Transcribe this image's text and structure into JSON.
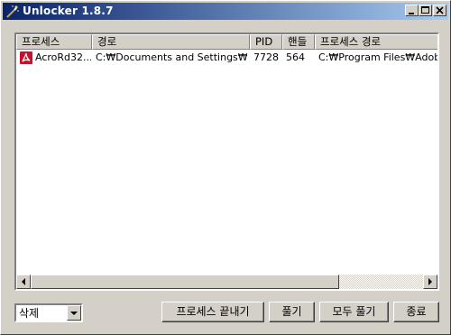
{
  "window": {
    "title": "Unlocker 1.8.7"
  },
  "list": {
    "columns": [
      "프로세스",
      "경로",
      "PID",
      "핸들",
      "프로세스 경로"
    ],
    "rows": [
      {
        "process": "AcroRd32...",
        "path": "C:₩Documents and Settings₩...",
        "pid": "7728",
        "handle": "564",
        "process_path": "C:₩Program Files₩Adobe₩"
      }
    ]
  },
  "action_select": {
    "value": "삭제"
  },
  "buttons": {
    "kill_process": "프로세스 끝내기",
    "unlock": "풀기",
    "unlock_all": "모두 풀기",
    "quit": "종료"
  },
  "icons": {
    "app": "wand-icon",
    "row": "acrobat-pdf-icon"
  }
}
